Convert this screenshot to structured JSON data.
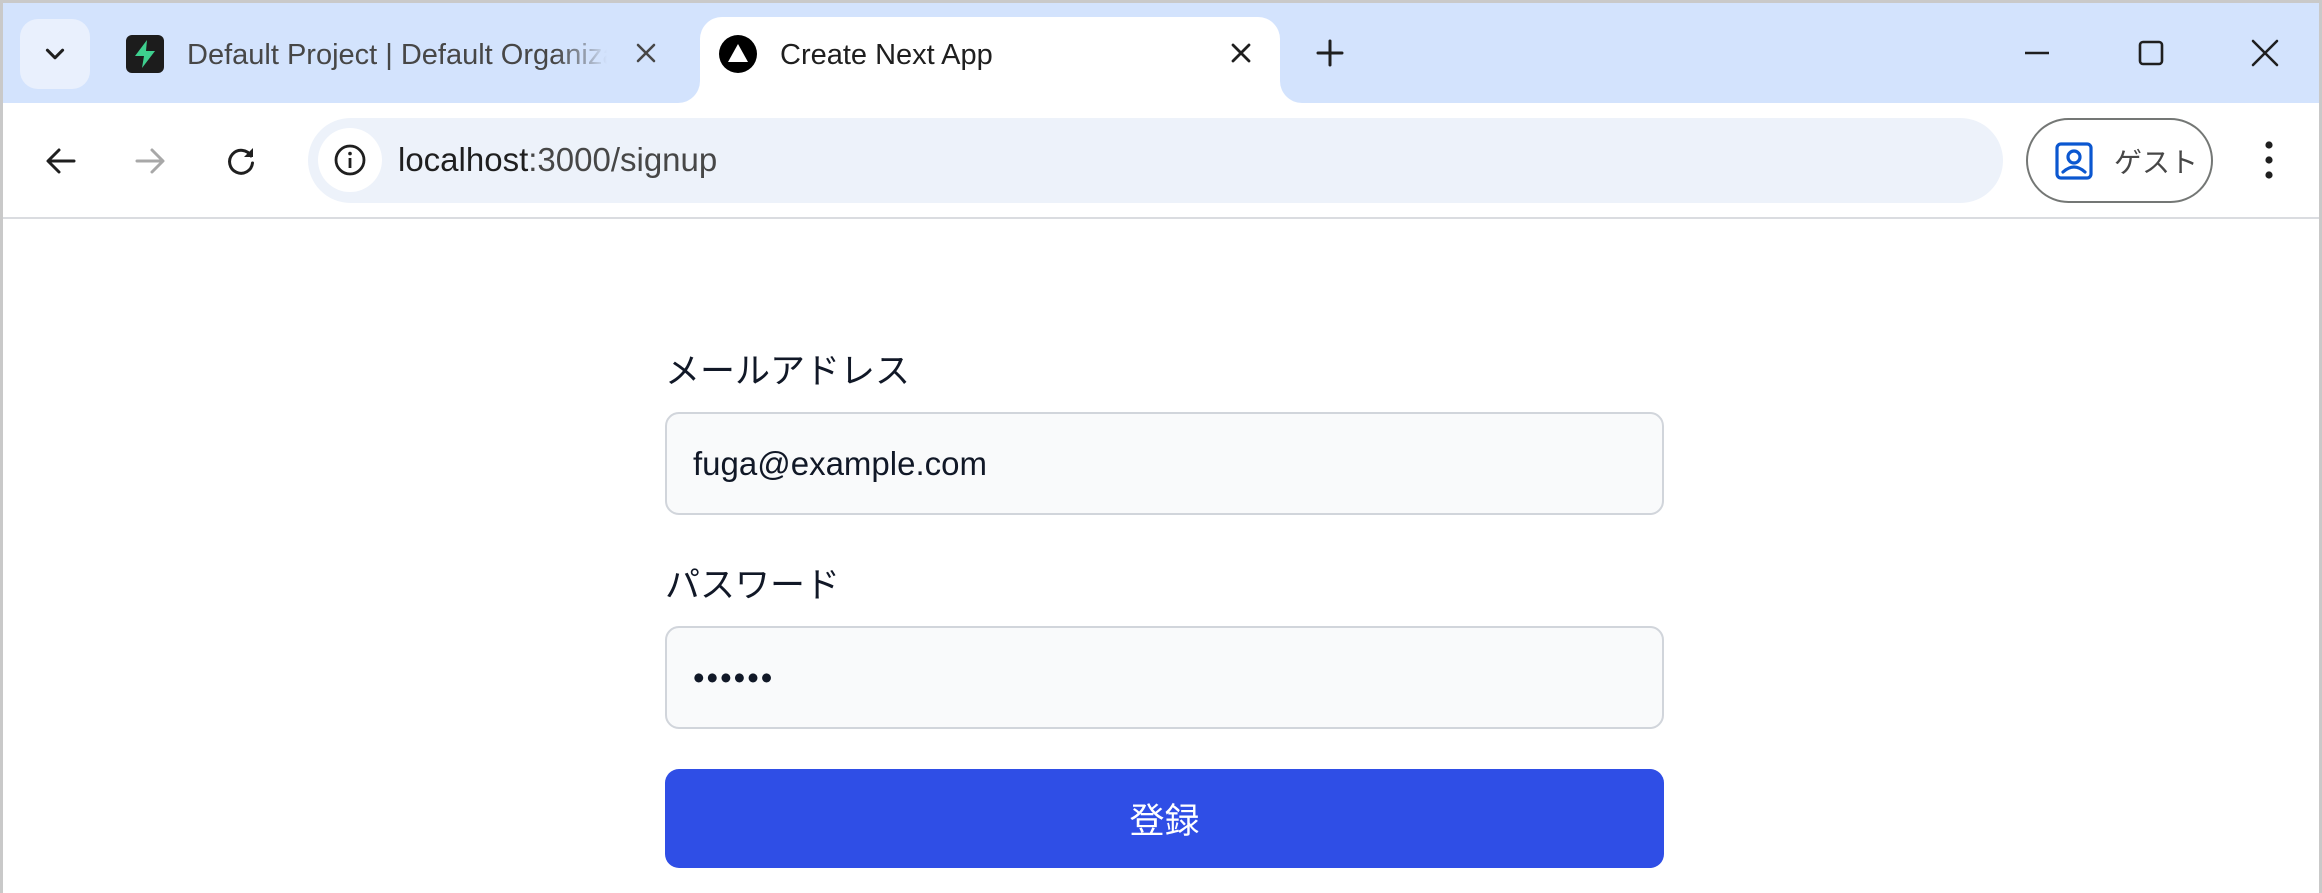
{
  "tabs": [
    {
      "title": "Default Project | Default Organization",
      "active": false,
      "favicon": "supabase-bolt-icon"
    },
    {
      "title": "Create Next App",
      "active": true,
      "favicon": "nextjs-triangle-icon"
    }
  ],
  "toolbar": {
    "url_host": "localhost",
    "url_path": ":3000/signup",
    "profile_label": "ゲスト"
  },
  "form": {
    "email_label": "メールアドレス",
    "email_value": "fuga@example.com",
    "password_label": "パスワード",
    "password_value": "••••••",
    "submit_label": "登録"
  },
  "colors": {
    "tabstrip_bg": "#d3e3fd",
    "omnibox_bg": "#edf2fa",
    "primary_button": "#2f4ee6",
    "input_bg": "#f9fafb",
    "input_border": "#d1d5db",
    "profile_icon": "#0b57d0"
  },
  "icons": {
    "tab_search": "chevron-down-icon",
    "new_tab": "plus-icon",
    "minimize": "minimize-icon",
    "maximize": "maximize-icon",
    "close_window": "close-icon",
    "back": "arrow-left-icon",
    "forward": "arrow-right-icon",
    "reload": "reload-icon",
    "site_info": "info-icon",
    "profile": "person-badge-icon",
    "menu": "kebab-menu-icon"
  }
}
